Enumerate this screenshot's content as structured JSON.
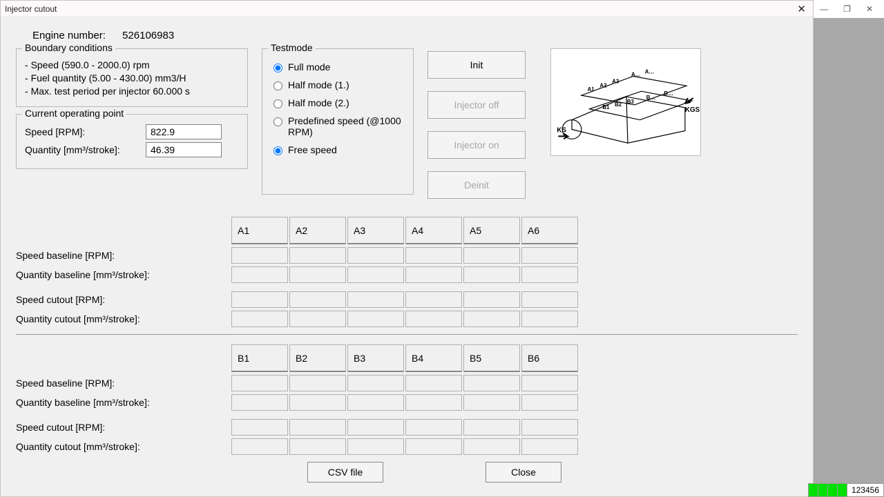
{
  "window": {
    "title": "Injector cutout"
  },
  "engine": {
    "label": "Engine number:",
    "value": "526106983"
  },
  "boundary": {
    "legend": "Boundary conditions",
    "items": [
      "Speed (590.0 - 2000.0) rpm",
      "Fuel quantity (5.00 - 430.00) mm3/H",
      "Max. test period per injector 60.000 s"
    ]
  },
  "cop": {
    "legend": "Current operating point",
    "speed_label": "Speed [RPM]:",
    "speed_value": "822.9",
    "qty_label": "Quantity [mm³/stroke]:",
    "qty_value": "46.39"
  },
  "testmode": {
    "legend": "Testmode",
    "full": "Full mode",
    "half1": "Half mode (1.)",
    "half2": "Half mode (2.)",
    "predef": "Predefined speed (@1000 RPM)",
    "free": "Free speed"
  },
  "buttons": {
    "init": "Init",
    "off": "Injector off",
    "on": "Injector on",
    "deinit": "Deinit"
  },
  "diagram": {
    "a1": "A1",
    "a2": "A2",
    "a3": "A3",
    "aDots": "A…",
    "b1": "B1",
    "b2": "B2",
    "b3": "B3",
    "bDots": "B…",
    "ks": "KS",
    "kgs": "KGS"
  },
  "tables": {
    "headersA": [
      "A1",
      "A2",
      "A3",
      "A4",
      "A5",
      "A6"
    ],
    "headersB": [
      "B1",
      "B2",
      "B3",
      "B4",
      "B5",
      "B6"
    ],
    "rowLabelsA": [
      "Speed baseline [RPM]:",
      "Quantity baseline [mm³/stroke]:",
      "Speed cutout  [RPM]:",
      "Quantity cutout  [mm³/stroke]:"
    ],
    "rowLabelsB": [
      "Speed baseline [RPM]:",
      "Quantity baseline [mm³/stroke]:",
      "Speed cutout [RPM]:",
      "Quantity cutout [mm³/stroke]:"
    ]
  },
  "footer": {
    "csv": "CSV file",
    "close": "Close"
  },
  "status": {
    "val": "123456"
  },
  "bg_controls": {
    "min": "—",
    "max": "❐",
    "close": "✕"
  }
}
